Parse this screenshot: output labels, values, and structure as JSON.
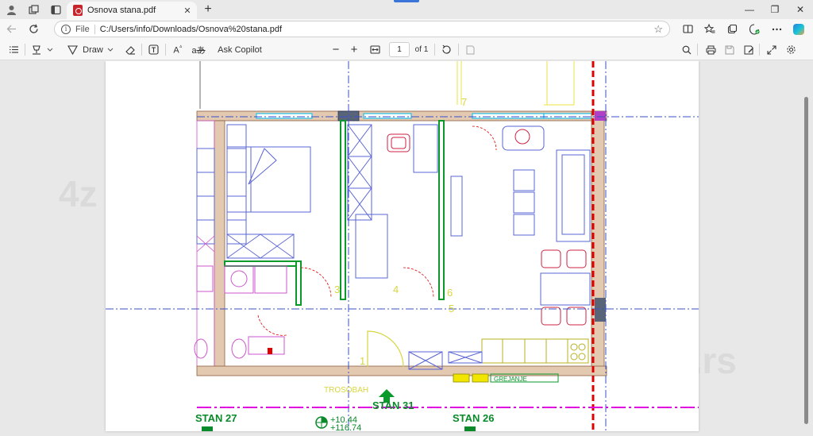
{
  "browser": {
    "tab": {
      "title": "Osnova stana.pdf",
      "close_glyph": "✕"
    },
    "new_tab_glyph": "+",
    "window_controls": {
      "minimize": "—",
      "restore": "❐",
      "close": "✕"
    }
  },
  "address_bar": {
    "scheme_label": "File",
    "url": "C:/Users/info/Downloads/Osnova%20stana.pdf"
  },
  "pdf_toolbar": {
    "draw_label": "Draw",
    "ask_copilot_label": "Ask Copilot",
    "zoom_out": "−",
    "zoom_in": "+",
    "page_current": "1",
    "page_total": "of 1"
  },
  "drawing": {
    "apartment_labels": [
      "STAN 27",
      "STAN 31",
      "STAN 26"
    ],
    "room_label_trosobah": "TROSOBAH",
    "heating_label": "GREJANJE",
    "elevation_1": "+10.44",
    "elevation_2": "+116.74",
    "room_numbers": [
      "7",
      "3",
      "4",
      "6",
      "1",
      "5"
    ]
  },
  "watermark": {
    "left": "4z",
    "right": "a.rs"
  },
  "colors": {
    "wall_fill": "#e3c9b0",
    "green_wall": "#0a9a2a",
    "blue_plan": "#5a64d4",
    "magenta": "#e000e0",
    "red_axis": "#e00000",
    "yellow": "#d8d640",
    "cyan_window": "#20c0e8"
  }
}
